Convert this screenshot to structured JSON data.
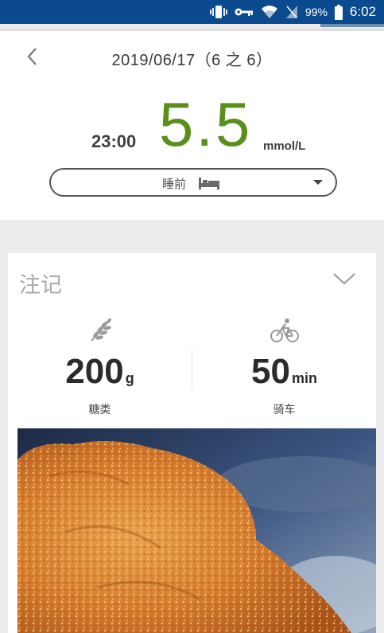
{
  "status_bar": {
    "battery": "99%",
    "time": "6:02",
    "icons": [
      "vibrate-icon",
      "key-icon",
      "wifi-icon",
      "no-sim-icon",
      "battery-icon"
    ]
  },
  "header": {
    "date_title": "2019/06/17（6 之 6）",
    "back_icon": "chevron-left-icon"
  },
  "reading": {
    "time": "23:00",
    "value": "5.5",
    "unit": "mmol/L",
    "value_color": "#5a8f1c"
  },
  "period_select": {
    "selected": "睡前",
    "icon": "bed-icon"
  },
  "notes": {
    "title": "注记",
    "carbs": {
      "value": "200",
      "unit": "g",
      "label": "糖类",
      "icon": "wheat-icon"
    },
    "exercise": {
      "value": "50",
      "unit": "min",
      "label": "骑车",
      "icon": "bicycle-icon"
    },
    "photo": "fried-chicken-photo"
  },
  "colors": {
    "status_bar": "#0b4a8f",
    "accent_green": "#5a8f1c"
  }
}
